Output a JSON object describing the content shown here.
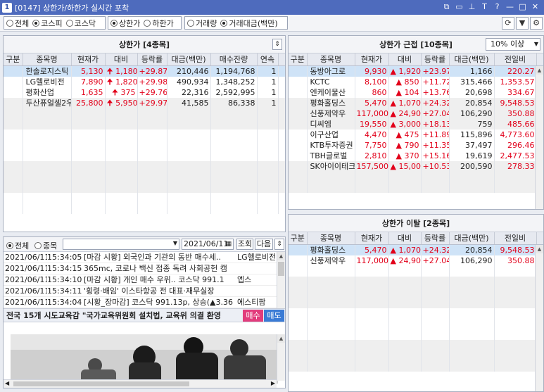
{
  "window": {
    "title_num": "1",
    "title": "[0147] 상한가/하한가 실시간 포착",
    "controls": [
      "⧉",
      "▭",
      "⊥",
      "T",
      "?",
      "—",
      "□",
      "✕"
    ]
  },
  "options": {
    "market": [
      {
        "label": "전체",
        "selected": false
      },
      {
        "label": "코스피",
        "selected": true
      },
      {
        "label": "코스닥",
        "selected": false
      }
    ],
    "limit": [
      {
        "label": "상한가",
        "selected": true
      },
      {
        "label": "하한가",
        "selected": false
      }
    ],
    "sort": [
      {
        "label": "거래량",
        "selected": false
      },
      {
        "label": "거래대금(백만)",
        "selected": true
      }
    ]
  },
  "upper": {
    "title": "상한가 [4종목]",
    "columns": [
      "구분",
      "종목명",
      "현재가",
      "대비",
      "등락률",
      "대금(백만)",
      "매수잔량",
      "연속"
    ],
    "rows": [
      {
        "name": "한솔로지스틱",
        "price": "5,130",
        "change": "1,180",
        "rate": "+29.87",
        "amount": "210,446",
        "bid": "1,194,768",
        "cont": "1"
      },
      {
        "name": "LG헬로비전",
        "price": "7,890",
        "change": "1,820",
        "rate": "+29.98",
        "amount": "490,934",
        "bid": "1,348,252",
        "cont": "1"
      },
      {
        "name": "평화산업",
        "price": "1,635",
        "change": "375",
        "rate": "+29.76",
        "amount": "22,316",
        "bid": "2,592,995",
        "cont": "1"
      },
      {
        "name": "두산퓨얼셀2우",
        "price": "25,800",
        "change": "5,950",
        "rate": "+29.97",
        "amount": "41,585",
        "bid": "86,338",
        "cont": "1"
      }
    ]
  },
  "near": {
    "title": "상한가 근접 [10종목]",
    "filter": "10% 이상",
    "columns": [
      "구분",
      "종목명",
      "현재가",
      "대비",
      "등락률",
      "대금(백만)",
      "전일비"
    ],
    "rows": [
      {
        "name": "동방아그로",
        "price": "9,930",
        "change": "1,920",
        "rate": "+23.97",
        "amount": "1,166",
        "prev": "220.27"
      },
      {
        "name": "KCTC",
        "price": "8,100",
        "change": "850",
        "rate": "+11.72",
        "amount": "315,466",
        "prev": "1,353.57"
      },
      {
        "name": "엔케이물산",
        "price": "860",
        "change": "104",
        "rate": "+13.76",
        "amount": "20,698",
        "prev": "334.67"
      },
      {
        "name": "평화홀딩스",
        "price": "5,470",
        "change": "1,070",
        "rate": "+24.32",
        "amount": "20,854",
        "prev": "9,548.53"
      },
      {
        "name": "신풍제약우",
        "price": "117,000",
        "change": "24,900",
        "rate": "+27.04",
        "amount": "106,290",
        "prev": "350.88"
      },
      {
        "name": "디씨엠",
        "price": "19,550",
        "change": "3,000",
        "rate": "+18.13",
        "amount": "759",
        "prev": "485.66"
      },
      {
        "name": "이구산업",
        "price": "4,470",
        "change": "475",
        "rate": "+11.89",
        "amount": "115,896",
        "prev": "4,773.60"
      },
      {
        "name": "KTB투자증권",
        "price": "7,750",
        "change": "790",
        "rate": "+11.35",
        "amount": "37,497",
        "prev": "296.46"
      },
      {
        "name": "TBH글로벌",
        "price": "2,810",
        "change": "370",
        "rate": "+15.16",
        "amount": "19,619",
        "prev": "2,477.53"
      },
      {
        "name": "SK아이이테크",
        "price": "157,500",
        "change": "15,000",
        "rate": "+10.53",
        "amount": "200,590",
        "prev": "278.33"
      }
    ]
  },
  "depart": {
    "title": "상한가 이탈 [2종목]",
    "columns": [
      "구분",
      "종목명",
      "현재가",
      "대비",
      "등락률",
      "대금(백만)",
      "전일비"
    ],
    "rows": [
      {
        "name": "평화홀딩스",
        "price": "5,470",
        "change": "1,070",
        "rate": "+24.32",
        "amount": "20,854",
        "prev": "9,548.53"
      },
      {
        "name": "신풍제약우",
        "price": "117,000",
        "change": "24,900",
        "rate": "+27.04",
        "amount": "106,290",
        "prev": "350.88"
      }
    ]
  },
  "news": {
    "filter_all": "전체",
    "filter_stock": "종목",
    "date": "2021/06/11",
    "search_label": "조회",
    "next_label": "다음",
    "items": [
      {
        "date": "2021/06/11",
        "time": "15:34:05",
        "text": "[마감 시황] 외국인과 기관의 동반 매수세..",
        "stock": "LG헬로비전"
      },
      {
        "date": "2021/06/11",
        "time": "15:34:15",
        "text": "365mc, 코로나 백신 접종 독려 사회공헌 캠",
        "stock": ""
      },
      {
        "date": "2021/06/11",
        "time": "15:34:10",
        "text": "[마감 시황] 개인 매수 우위.. 코스닥 991.1",
        "stock": "엡스"
      },
      {
        "date": "2021/06/11",
        "time": "15:34:11",
        "text": "'횡령·배임' 이스타항공 전 대표·재무실장",
        "stock": ""
      },
      {
        "date": "2021/06/11",
        "time": "15:34:04",
        "text": "[시황_장마감] 코스닥 991.13p, 상승(▲3.36",
        "stock": "에스티팜"
      }
    ],
    "headline": "전국 15개 시도교육감 \"국가교육위원회 설치법, 교육위 의결 환영",
    "buy_label": "매수",
    "sell_label": "매도"
  }
}
